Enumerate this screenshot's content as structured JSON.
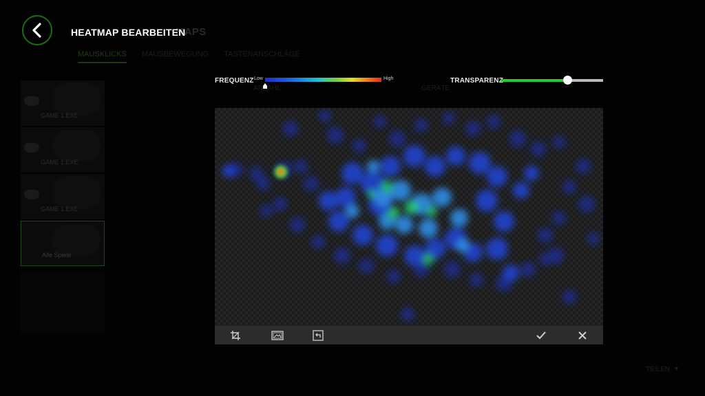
{
  "background": {
    "title_fragment": "MAPS",
    "tabs": [
      "MAUSKLICKS",
      "MAUSBEWEGUNG",
      "TASTENANSCHLÄGE"
    ],
    "games": [
      "GAME 1.EXE",
      "GAME 1.EXE",
      "GAME 1.EXE",
      "Alle Spiele"
    ],
    "column_label_1": "ANZAHL",
    "column_label_2": "GERÄTE",
    "share_label": "TEILEN"
  },
  "header": {
    "title": "HEATMAP BEARBEITEN",
    "back_icon": "chevron-left-icon",
    "accent_color": "#1b6e14"
  },
  "frequency": {
    "label": "FREQUENZ",
    "low_label": "Low",
    "high_label": "High",
    "marker_value": 0.0
  },
  "transparency": {
    "label": "TRANSPARENZ",
    "value": 0.65,
    "fill_color": "#22d022"
  },
  "toolbar": {
    "crop_icon": "crop-icon",
    "image_icon": "image-icon",
    "reset_icon": "reset-icon",
    "confirm_icon": "check-icon",
    "cancel_icon": "close-icon"
  }
}
